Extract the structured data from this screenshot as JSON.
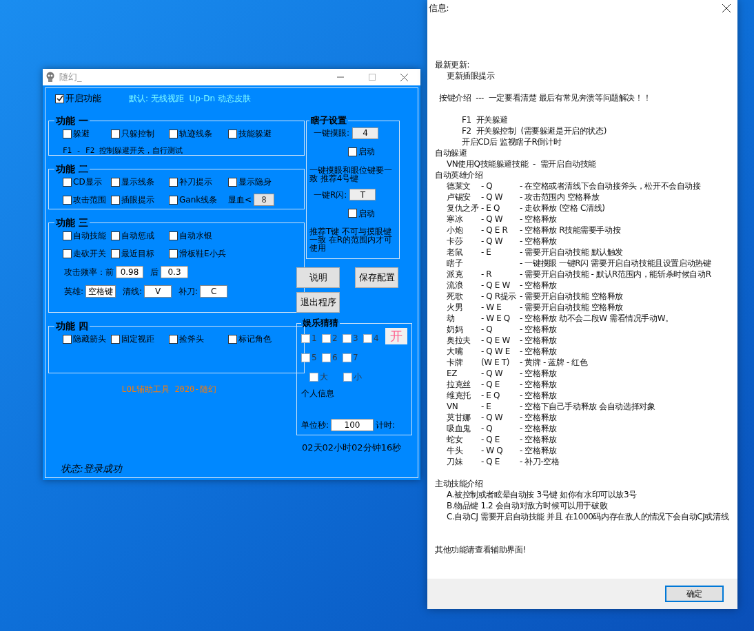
{
  "main_window": {
    "title": "随幻_",
    "enable": {
      "label": "开启功能",
      "checked": true
    },
    "hint": "默认: 无线视距  Up-Dn 动态皮肤",
    "groups": [
      {
        "title": "功能 一",
        "rows": [
          {
            "kind": "grid",
            "items": [
              {
                "kind": "checkbox",
                "label": "躲避",
                "checked": false
              },
              {
                "kind": "checkbox",
                "label": "只躲控制",
                "checked": false
              },
              {
                "kind": "checkbox",
                "label": "轨迹线条",
                "checked": false
              },
              {
                "kind": "checkbox",
                "label": "技能躲避",
                "checked": false
              }
            ]
          },
          {
            "kind": "note",
            "text": "F1 - F2 控制躲避开关，自行测试"
          }
        ]
      },
      {
        "title": "功能 二",
        "rows": [
          {
            "kind": "grid",
            "items": [
              {
                "kind": "checkbox",
                "label": "CD显示",
                "checked": false
              },
              {
                "kind": "checkbox",
                "label": "显示线条",
                "checked": false
              },
              {
                "kind": "checkbox",
                "label": "补刀提示",
                "checked": false
              },
              {
                "kind": "checkbox",
                "label": "显示隐身",
                "checked": false
              }
            ]
          },
          {
            "kind": "grid",
            "items": [
              {
                "kind": "checkbox",
                "label": "攻击范围",
                "checked": false
              },
              {
                "kind": "checkbox",
                "label": "插眼提示",
                "checked": false
              },
              {
                "kind": "checkbox",
                "label": "Gank线条",
                "checked": false
              },
              {
                "kind": "field",
                "label": "显血<",
                "value": "8",
                "disabled": true
              }
            ]
          }
        ]
      },
      {
        "title": "功能 三",
        "rows": [
          {
            "kind": "grid",
            "items": [
              {
                "kind": "checkbox",
                "label": "自动技能",
                "checked": false
              },
              {
                "kind": "checkbox",
                "label": "自动惩戒",
                "checked": false
              },
              {
                "kind": "checkbox",
                "label": "自动水银",
                "checked": false
              }
            ]
          },
          {
            "kind": "grid",
            "items": [
              {
                "kind": "checkbox",
                "label": "走砍开关",
                "checked": false
              },
              {
                "kind": "checkbox",
                "label": "最近目标",
                "checked": false
              },
              {
                "kind": "checkbox",
                "label": "滑板鞋E小兵",
                "checked": false
              }
            ]
          },
          {
            "kind": "inline",
            "items": [
              {
                "kind": "field",
                "label": "攻击频率：前",
                "value": "0.98",
                "disabled": false
              },
              {
                "kind": "field",
                "label": "后",
                "value": "0.3",
                "disabled": false
              }
            ]
          },
          {
            "kind": "inline",
            "items": [
              {
                "kind": "field",
                "label": "英雄:",
                "value": "空格键",
                "disabled": false
              },
              {
                "kind": "field",
                "label": "清线:",
                "value": "V",
                "disabled": false
              },
              {
                "kind": "field",
                "label": "补刀:",
                "value": "C",
                "disabled": false
              }
            ]
          }
        ]
      },
      {
        "title": "功能 四",
        "rows": [
          {
            "kind": "grid",
            "items": [
              {
                "kind": "checkbox",
                "label": "隐藏箭头",
                "checked": false
              },
              {
                "kind": "checkbox",
                "label": "固定视距",
                "checked": false
              },
              {
                "kind": "checkbox",
                "label": "捡斧头",
                "checked": false
              },
              {
                "kind": "checkbox",
                "label": "标记角色",
                "checked": false
              }
            ]
          }
        ]
      }
    ],
    "footer": "LOL辅助工具 2020-随幻",
    "status": "状态:登录成功",
    "lee_sin": {
      "title": "瞎子设置",
      "items": [
        {
          "kind": "hotkey",
          "label": "一键摸眼:",
          "value": "4"
        },
        {
          "kind": "checkbox",
          "label": "启动",
          "checked": false
        },
        {
          "kind": "note",
          "text": "一键摸眼和眼位键要一致 推荐4号键"
        },
        {
          "kind": "hotkey",
          "label": "一键R闪:",
          "value": "T"
        },
        {
          "kind": "checkbox",
          "label": "启动",
          "checked": false
        },
        {
          "kind": "note",
          "text": "推荐T键 不可与摸眼键一致 在R的范围内才可使用"
        }
      ]
    },
    "buttons": [
      "说明",
      "保存配置",
      "退出程序"
    ],
    "fun": {
      "title": "娱乐猜猜",
      "numbers": [
        {
          "label": "1",
          "checked": false
        },
        {
          "label": "2",
          "checked": false
        },
        {
          "label": "3",
          "checked": false
        },
        {
          "label": "4",
          "checked": false
        },
        {
          "label": "5",
          "checked": false
        },
        {
          "label": "6",
          "checked": false
        },
        {
          "label": "7",
          "checked": false
        }
      ],
      "toggle": "开",
      "sizes": [
        {
          "label": "大",
          "checked": false
        },
        {
          "label": "小",
          "checked": false
        }
      ],
      "info": "个人信息",
      "unit_label": "单位秒:",
      "unit_value": "100",
      "timer_label": "计时:"
    },
    "timer": "02天02小时02分钟16秒"
  },
  "info_window": {
    "title": "信息:",
    "sections": [
      {
        "heading": "最新更新:",
        "lines": [
          "更新插眼提示"
        ]
      },
      {
        "heading": "按键介绍  ---  一定要看清楚 最后有常见奔溃等问题解决！！",
        "lines": [
          "F1  开关躲避",
          "F2  开关躲控制  (需要躲避是开启的状态)",
          "开启CD后 监视瞎子R倒计时"
        ]
      },
      {
        "heading": "自动躲避",
        "lines": [
          "VN使用Q技能躲避技能  -  需开启自动技能"
        ]
      },
      {
        "heading": "自动英雄介绍",
        "heroes": [
          {
            "name": "德莱文",
            "keys": "- Q",
            "desc": "- 在空格或者清线下会自动接斧头，松开不会自动接"
          },
          {
            "name": "卢锡安",
            "keys": "- Q W",
            "desc": "- 攻击范围内 空格释放"
          },
          {
            "name": "复仇之矛",
            "keys": "- E Q",
            "desc": "- 走砍释放  (空格 C清线)"
          },
          {
            "name": "寒冰",
            "keys": "- Q W",
            "desc": "- 空格释放"
          },
          {
            "name": "小炮",
            "keys": "- Q E R",
            "desc": "- 空格释放 R技能需要手动按"
          },
          {
            "name": "卡莎",
            "keys": "- Q W",
            "desc": "- 空格释放"
          },
          {
            "name": "老鼠",
            "keys": "- E",
            "desc": "- 需要开启自动技能 默认触发"
          },
          {
            "name": "瞎子",
            "desc": "- 一键摸眼 一键R闪 需要开启自动技能且设置启动热键"
          },
          {
            "name": "派克",
            "keys": "- R",
            "desc": "- 需要开启自动技能 - 默认R范围内，能斩杀时候自动R"
          },
          {
            "name": "流浪",
            "keys": "- Q E W",
            "desc": "- 空格释放"
          },
          {
            "name": "死歌",
            "keys": "- Q R提示",
            "desc": "- 需要开启自动技能 空格释放"
          },
          {
            "name": "火男",
            "keys": "- W E",
            "desc": "- 需要开启自动技能 空格释放"
          },
          {
            "name": "劫",
            "keys": "- W E Q",
            "desc": "- 空格释放 劫不会二段W 需看情况手动W。"
          },
          {
            "name": "奶妈",
            "keys": "- Q",
            "desc": "- 空格释放"
          },
          {
            "name": "奥拉夫",
            "keys": "- Q E W",
            "desc": "- 空格释放"
          },
          {
            "name": "大嘴",
            "keys": "- Q W E",
            "desc": "- 空格释放"
          },
          {
            "name": "卡牌",
            "keys": "(W E T)",
            "desc": "- 黄牌 - 蓝牌 - 红色"
          },
          {
            "name": "EZ",
            "keys": "- Q W",
            "desc": "- 空格释放"
          },
          {
            "name": "拉克丝",
            "keys": "- Q E",
            "desc": "- 空格释放"
          },
          {
            "name": "维克托",
            "keys": "- E Q",
            "desc": "- 空格释放"
          },
          {
            "name": "VN",
            "keys": "- E",
            "desc": "- 空格下自己手动释放 会自动选择对象"
          },
          {
            "name": "莫甘娜",
            "keys": "- Q W",
            "desc": "- 空格释放"
          },
          {
            "name": "吸血鬼",
            "keys": "- Q",
            "desc": "- 空格释放"
          },
          {
            "name": "蛇女",
            "keys": "- Q E",
            "desc": "- 空格释放"
          },
          {
            "name": "牛头",
            "keys": "- W Q",
            "desc": "- 空格释放"
          },
          {
            "name": "刀妹",
            "keys": "- Q E",
            "desc": "- 补刀-空格"
          }
        ]
      },
      {
        "heading": "主动技能介绍",
        "lines": [
          "A.被控制或者眩晕自动按 3号键 如你有水印可以放3号",
          "B.物品键 1.2 会自动对敌方时候可以用于破败",
          "C.自动CJ 需要开启自动技能 并且 在1000码内存在敌人的情况下会自动CJ或清线"
        ]
      },
      {
        "heading": "其他功能请查看辅助界面!"
      }
    ],
    "ok_button": "确定"
  }
}
